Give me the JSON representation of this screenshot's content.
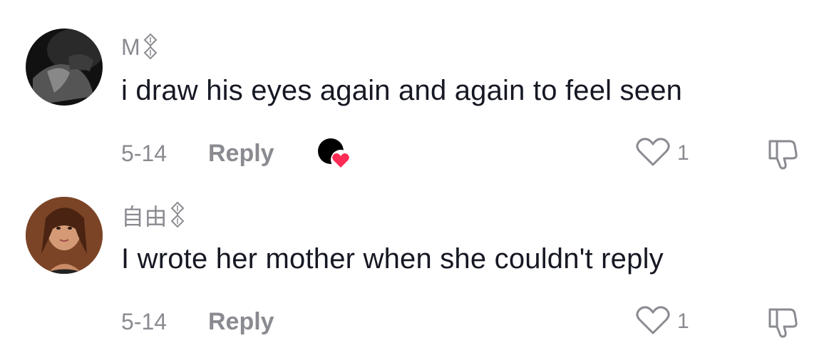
{
  "comments": [
    {
      "username": "M",
      "flair_icon": "diamond-chain-icon",
      "text": "i draw his eyes again and again to feel seen",
      "date": "5-14",
      "reply_label": "Reply",
      "likes": "1",
      "creator_liked": true
    },
    {
      "username": "自由",
      "flair_icon": "diamond-chain-icon",
      "text": "I wrote her mother when she couldn't reply",
      "date": "5-14",
      "reply_label": "Reply",
      "likes": "1",
      "creator_liked": false
    }
  ],
  "colors": {
    "text": "#161823",
    "muted": "#8a8b91",
    "heart_accent": "#fe2c55"
  }
}
